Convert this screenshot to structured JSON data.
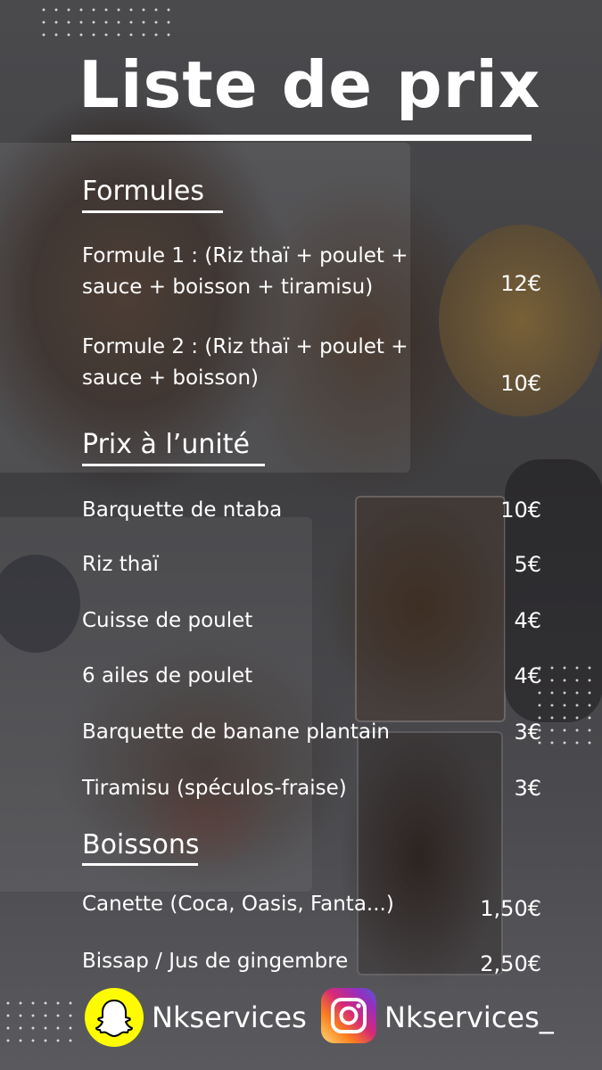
{
  "title": "Liste de prix",
  "sections": [
    {
      "heading": "Formules",
      "items": [
        {
          "label_lines": [
            "Formule 1 : (Riz thaï + poulet +",
            "sauce + boisson + tiramisu)"
          ],
          "price": "12€"
        },
        {
          "label_lines": [
            "Formule 2 : (Riz thaï + poulet +",
            "sauce + boisson)"
          ],
          "price": "10€"
        }
      ]
    },
    {
      "heading": "Prix à l’unité",
      "items": [
        {
          "label": "Barquette de ntaba",
          "price": "10€"
        },
        {
          "label": "Riz thaï",
          "price": "5€"
        },
        {
          "label": "Cuisse de poulet",
          "price": "4€"
        },
        {
          "label": "6 ailes de poulet",
          "price": "4€"
        },
        {
          "label": "Barquette de banane plantain",
          "price": "3€"
        },
        {
          "label": "Tiramisu (spéculos-fraise)",
          "price": "3€"
        }
      ]
    },
    {
      "heading": "Boissons",
      "items": [
        {
          "label": "Canette (Coca, Oasis, Fanta...)",
          "price": "1,50€"
        },
        {
          "label": "Bissap / Jus de gingembre",
          "price": "2,50€"
        }
      ]
    }
  ],
  "footer": {
    "snapchat": {
      "icon": "snapchat-icon",
      "handle": "Nkservices",
      "color": "#FFFC00"
    },
    "instagram": {
      "icon": "instagram-icon",
      "handle": "Nkservices_"
    }
  }
}
